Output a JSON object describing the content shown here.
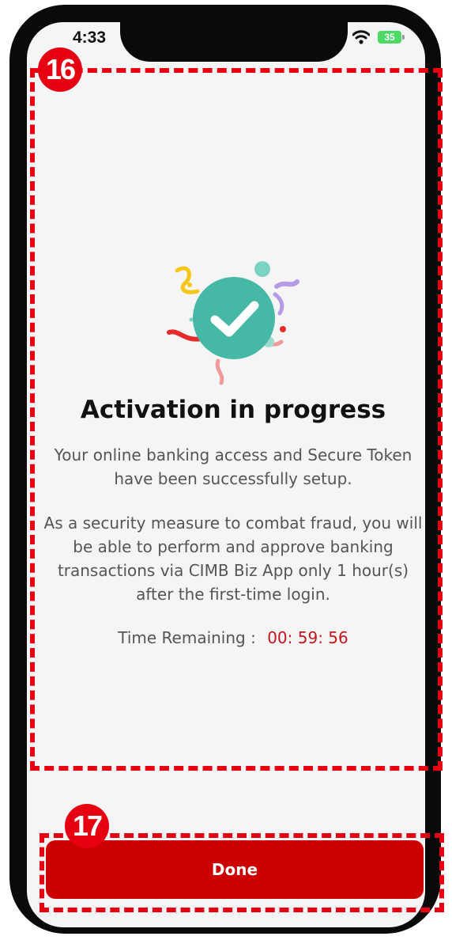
{
  "status_bar": {
    "time": "4:33",
    "battery": "35"
  },
  "annotations": {
    "badge_16": "16",
    "badge_17": "17"
  },
  "content": {
    "title": "Activation in progress",
    "paragraph_1": "Your online banking access and Secure Token have been successfully setup.",
    "paragraph_2": "As a security measure to combat fraud, you will be able to perform and approve banking transactions via CIMB Biz App only 1 hour(s) after the first-time login.",
    "timer_label": "Time Remaining :",
    "timer_value": "00: 59: 56"
  },
  "footer": {
    "done_label": "Done"
  },
  "colors": {
    "accent": "#cc0000",
    "annotation": "#e60012",
    "check_circle": "#45b8a6",
    "timer": "#c4161c"
  },
  "icons": {
    "success": "check-circle-icon",
    "wifi": "wifi-icon",
    "battery": "battery-icon"
  }
}
